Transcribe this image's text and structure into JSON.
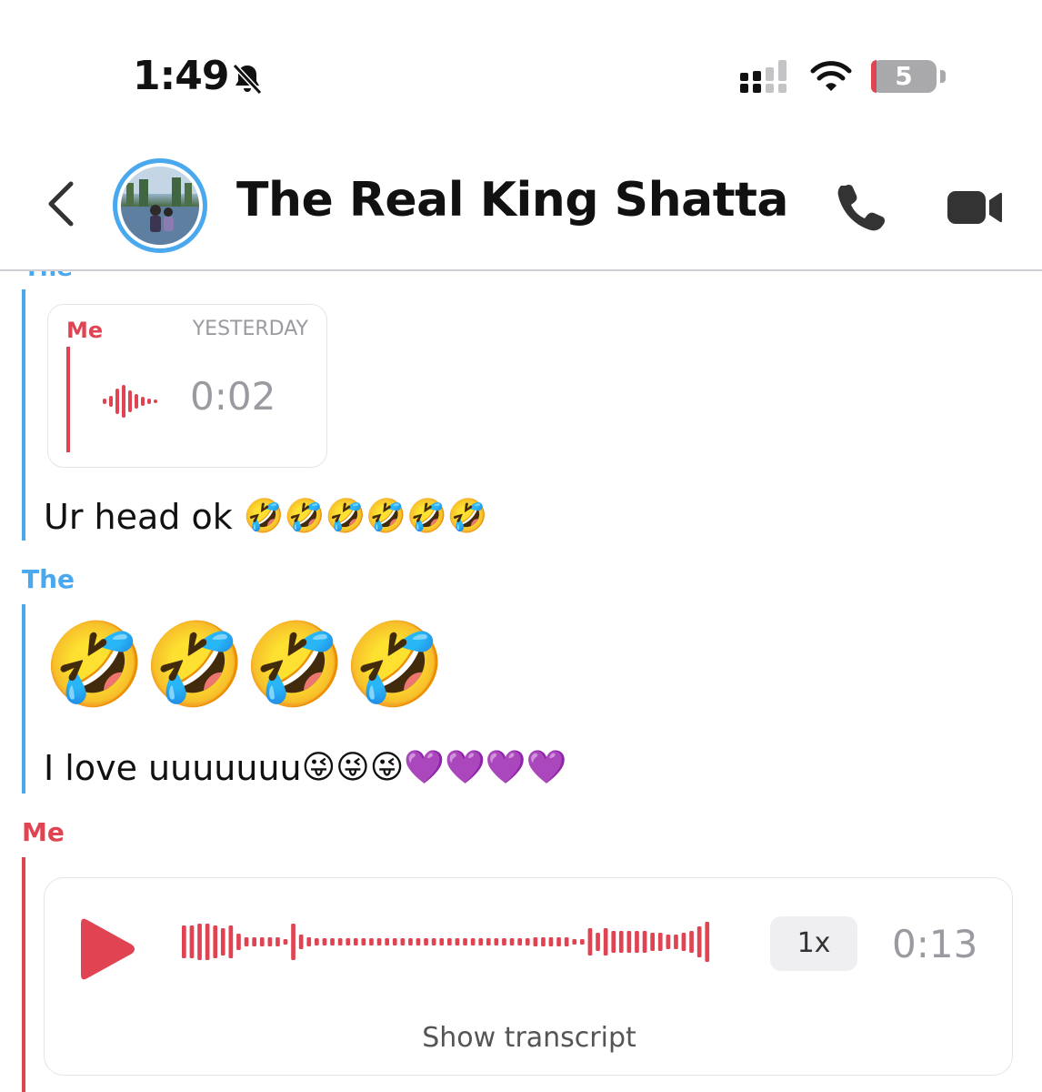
{
  "status_bar": {
    "time": "1:49",
    "battery": "5"
  },
  "header": {
    "title": "The Real King Shatta"
  },
  "chat": {
    "cut_label": "The",
    "quoted_card": {
      "sender": "Me",
      "date": "YESTERDAY",
      "duration": "0:02"
    },
    "message_1": {
      "text": "Ur head ok ",
      "emojis": "🤣🤣🤣🤣🤣🤣"
    },
    "sender_2": "The",
    "big_emojis": "🤣🤣🤣🤣",
    "message_2": {
      "text": "I love uuuuuuu",
      "emojis": "😜😜😜💜💜💜💜"
    },
    "sender_3": "Me",
    "voice_note": {
      "speed": "1x",
      "duration": "0:13",
      "transcript_label": "Show transcript"
    }
  },
  "colors": {
    "accent_blue": "#49a8ee",
    "accent_red": "#e04452",
    "muted": "#9a9aa0"
  }
}
